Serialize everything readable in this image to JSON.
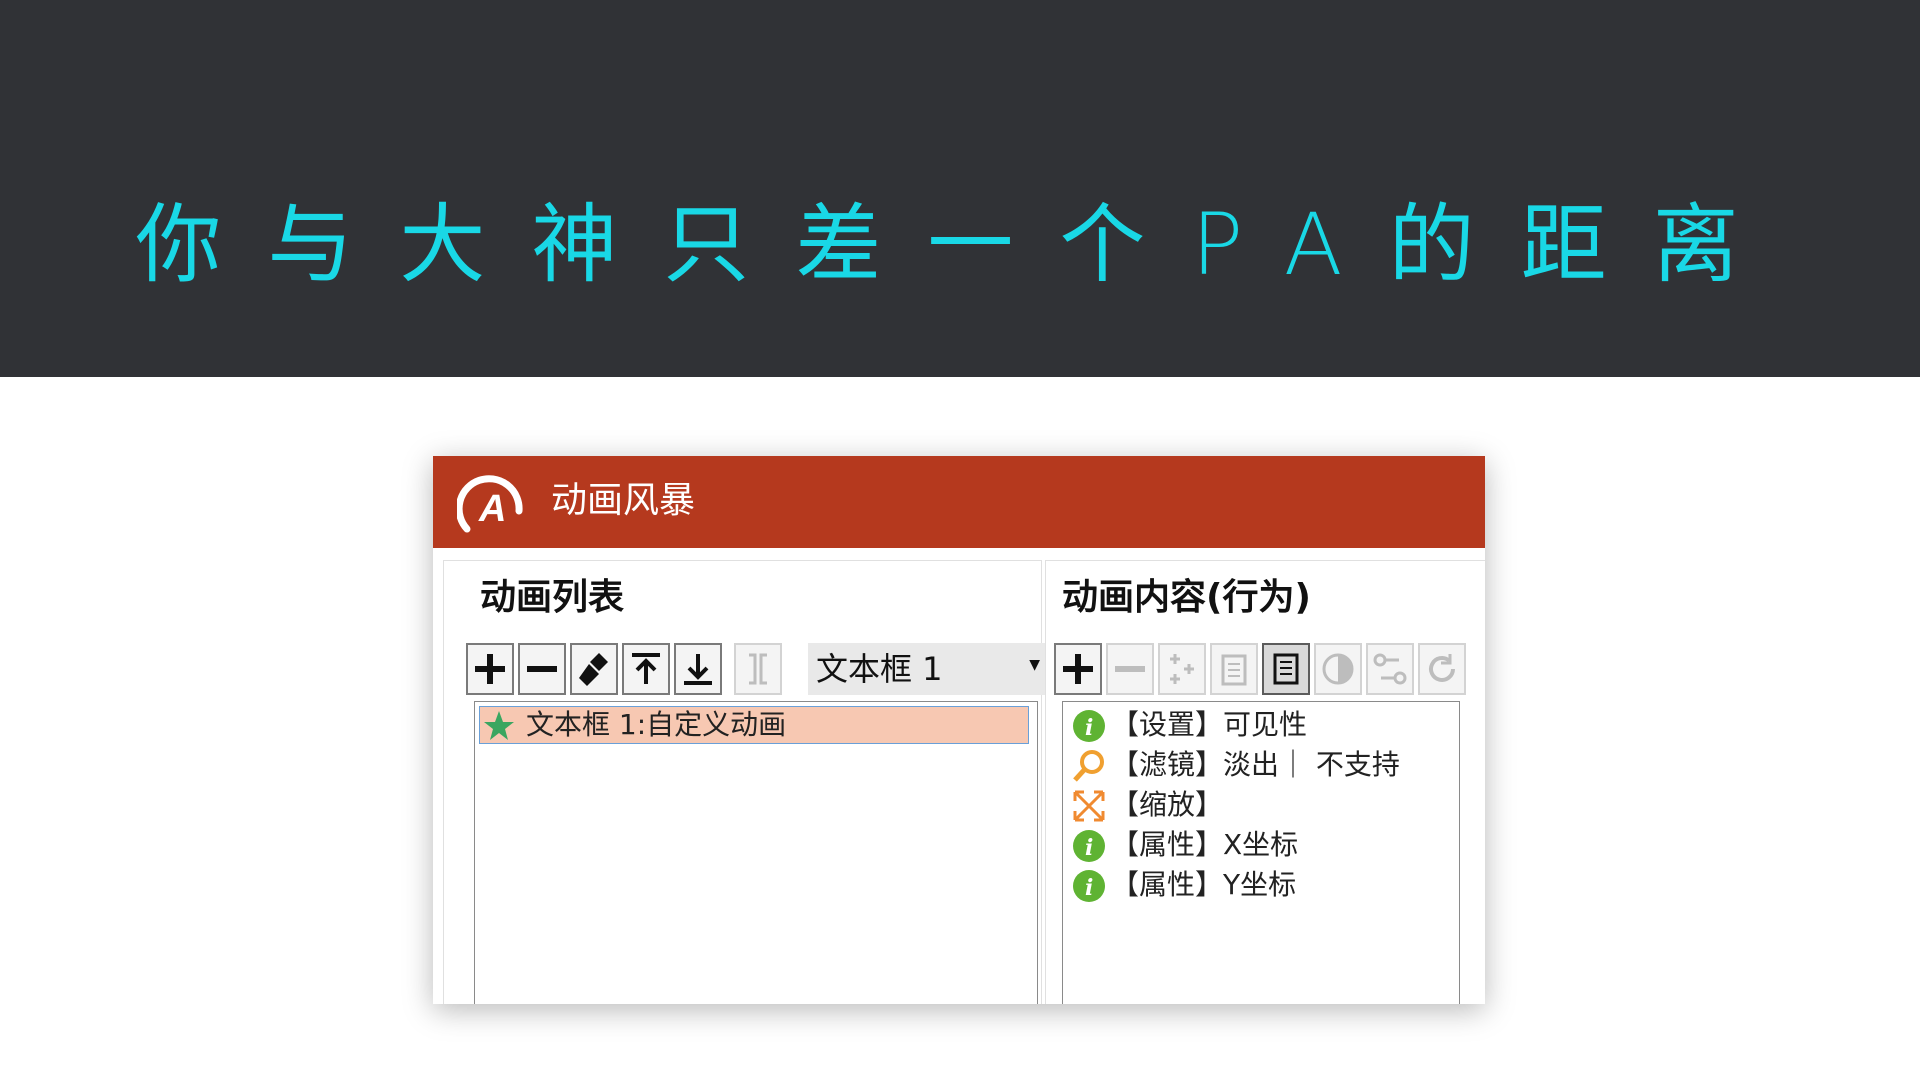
{
  "banner": {
    "headline": "你与大神只差一个PA的距离"
  },
  "window": {
    "title": "动画风暴",
    "colors": {
      "titlebar": "#b5391e",
      "headline": "#19d8e6",
      "banner": "#303236"
    }
  },
  "left_pane": {
    "title": "动画列表",
    "toolbar": [
      {
        "name": "add-icon",
        "enabled": true
      },
      {
        "name": "remove-icon",
        "enabled": true
      },
      {
        "name": "brush-icon",
        "enabled": true
      },
      {
        "name": "move-top-icon",
        "enabled": true
      },
      {
        "name": "move-bottom-icon",
        "enabled": true
      },
      {
        "name": "bracket-icon",
        "enabled": false
      }
    ],
    "target_select": "文本框 1",
    "items": [
      {
        "icon": "star-icon",
        "label": "文本框 1:自定义动画",
        "selected": true
      }
    ]
  },
  "right_pane": {
    "title": "动画内容(行为)",
    "toolbar": [
      {
        "name": "add-icon",
        "enabled": true
      },
      {
        "name": "remove-icon",
        "enabled": false
      },
      {
        "name": "sparkle-icon",
        "enabled": false
      },
      {
        "name": "clipboard-icon",
        "enabled": false
      },
      {
        "name": "document-icon",
        "enabled": true,
        "active": true
      },
      {
        "name": "half-circle-icon",
        "enabled": false
      },
      {
        "name": "path-icon",
        "enabled": false
      },
      {
        "name": "refresh-icon",
        "enabled": false
      }
    ],
    "actions": [
      {
        "icon": "info-icon",
        "label": "【设置】可见性"
      },
      {
        "icon": "magnifier-icon",
        "label": "【滤镜】淡出｜ 不支持"
      },
      {
        "icon": "scale-icon",
        "label": "【缩放】"
      },
      {
        "icon": "info-icon",
        "label": "【属性】X坐标"
      },
      {
        "icon": "info-icon",
        "label": "【属性】Y坐标"
      }
    ]
  }
}
